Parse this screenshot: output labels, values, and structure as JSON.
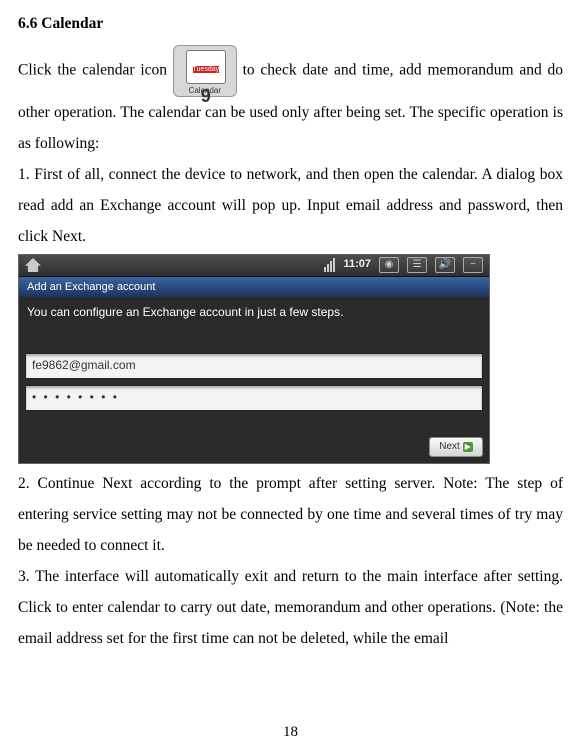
{
  "heading": "6.6 Calendar",
  "intro_before_icon": "Click the calendar icon ",
  "intro_after_icon": " to check date and time, add memorandum and do other operation. The calendar can be used only after being set. The specific operation is as following:",
  "calendar_icon": {
    "month": "Tuesday",
    "day": "9",
    "label": "Calendar"
  },
  "step1": "1. First of all, connect the device to network, and then open the calendar. A dialog box read add an Exchange account will pop up. Input email address and password, then click Next.",
  "screenshot": {
    "time": "11:07",
    "bluebar": "Add an Exchange account",
    "instruction": "You can configure an Exchange account in just a few steps.",
    "email": "fe9862@gmail.com",
    "password_mask": "• • • • • • • •",
    "next_label": "Next"
  },
  "step2": "2. Continue Next according to the prompt after setting server. Note: The step of entering service setting may not be connected by one time and several times of try may be needed to connect it.",
  "step3": "3. The interface will automatically exit and return to the main interface after setting. Click to enter calendar to carry out date, memorandum and other operations. (Note: the email address set for the first time   can  not  be  deleted,  while  the  email",
  "page_number": "18"
}
